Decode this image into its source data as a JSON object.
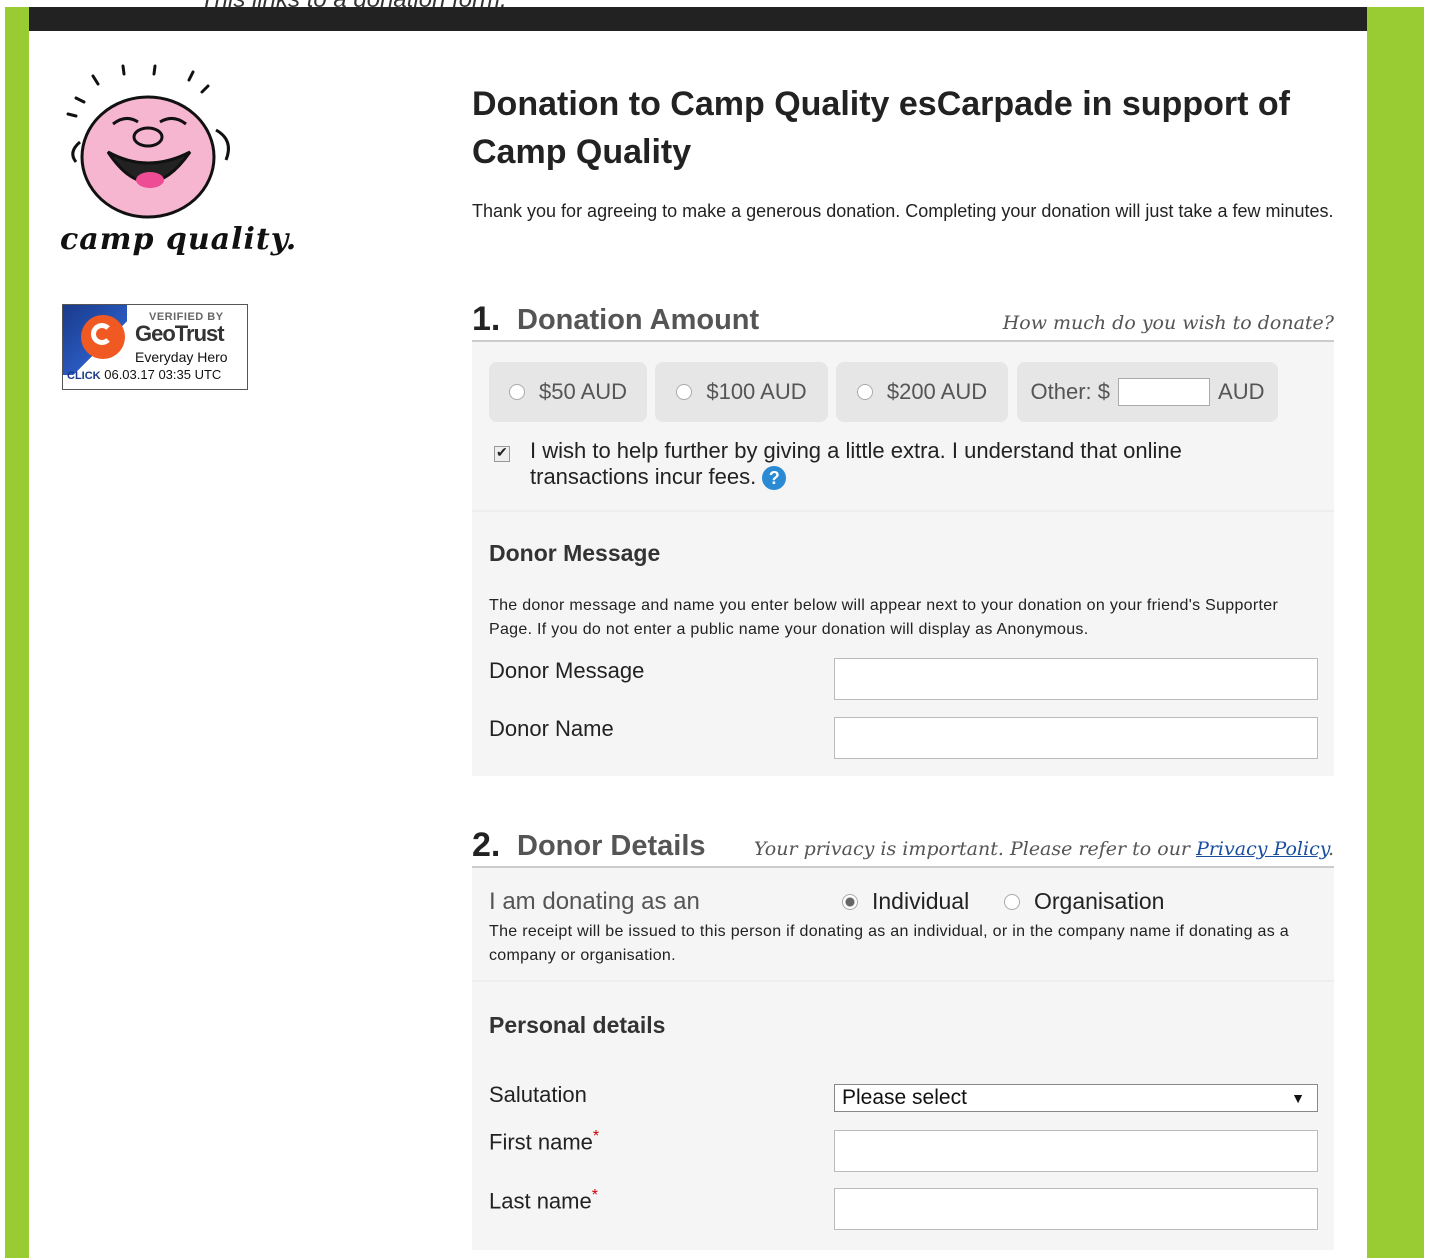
{
  "caption": "This links to a donation form.",
  "logo": {
    "text": "camp quality."
  },
  "geotrust": {
    "verified": "VERIFIED BY",
    "brand": "GeoTrust",
    "subtitle": "Everyday Hero",
    "click": "CLICK",
    "timestamp": "06.03.17 03:35 UTC"
  },
  "page": {
    "title": "Donation to Camp Quality esCarpade in support of Camp Quality",
    "intro": "Thank you for agreeing to make a generous donation. Completing your donation will just take a few minutes."
  },
  "section1": {
    "number": "1.",
    "title": "Donation Amount",
    "hint": "How much do you wish to donate?",
    "options": [
      {
        "label": "$50 AUD"
      },
      {
        "label": "$100 AUD"
      },
      {
        "label": "$200 AUD"
      }
    ],
    "other_prefix": "Other: $",
    "other_suffix": "AUD",
    "extra_checkbox": "I wish to help further by giving a little extra. I understand that online transactions incur fees.",
    "help_icon": "?"
  },
  "donor_message": {
    "heading": "Donor Message",
    "description": "The donor message and name you enter below will appear next to your donation on your friend's Supporter Page. If you do not enter a public name your donation will display as Anonymous.",
    "message_label": "Donor Message",
    "name_label": "Donor Name"
  },
  "section2": {
    "number": "2.",
    "title": "Donor Details",
    "hint_prefix": "Your privacy is important. Please refer to our ",
    "hint_link": "Privacy Policy",
    "hint_suffix": ".",
    "donating_as": "I am donating as an",
    "individual": "Individual",
    "organisation": "Organisation",
    "receipt_note": "The receipt will be issued to this person if donating as an individual, or in the company name if donating as a company or organisation."
  },
  "personal": {
    "heading": "Personal details",
    "salutation_label": "Salutation",
    "salutation_value": "Please select",
    "first_name_label": "First name",
    "last_name_label": "Last name",
    "required_mark": "*"
  }
}
